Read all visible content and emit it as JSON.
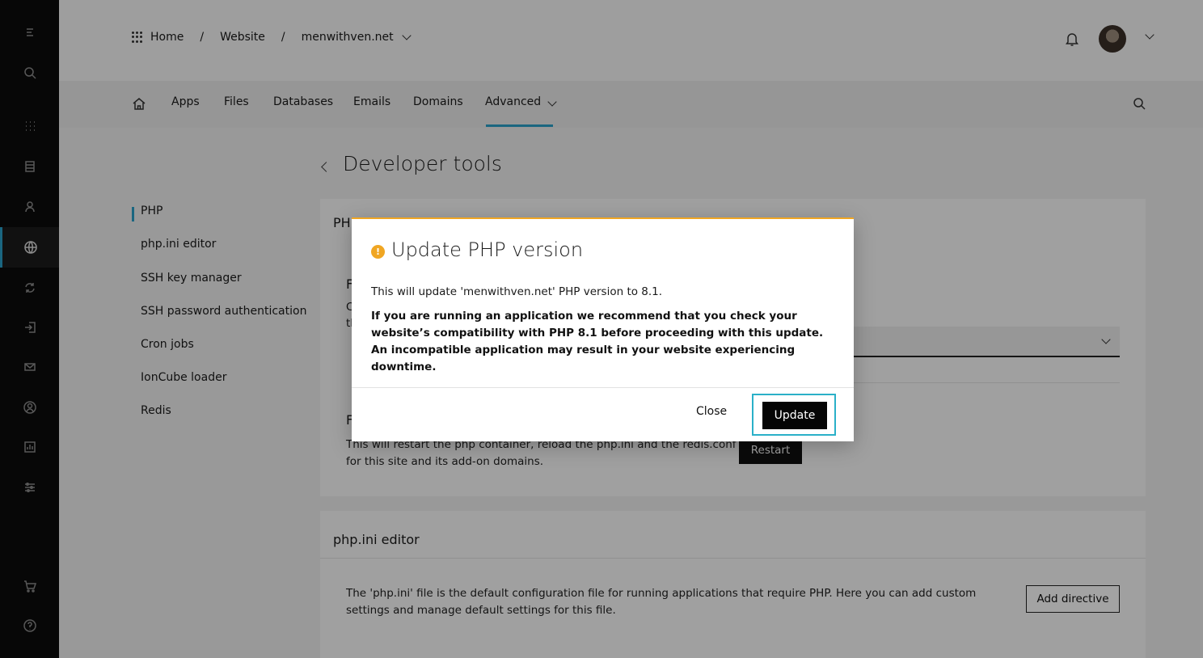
{
  "breadcrumb": {
    "items": [
      "Home",
      "Website",
      "menwithven.net"
    ],
    "separator": "/"
  },
  "nav": {
    "tabs": [
      "Apps",
      "Files",
      "Databases",
      "Emails",
      "Domains",
      "Advanced"
    ],
    "active_tab": "Advanced"
  },
  "page": {
    "title": "Developer tools"
  },
  "subnav": {
    "items": [
      "PHP",
      "php.ini editor",
      "SSH key manager",
      "SSH password authentication",
      "Cron jobs",
      "IonCube loader",
      "Redis"
    ],
    "active": "PHP"
  },
  "php_card": {
    "title_fragment": "PH",
    "section_fragment": "F",
    "text_fragment_1": "C",
    "text_fragment_2": "tl",
    "restart_fragment": "F",
    "restart_text": "This will restart the php container, reload the php.ini and the redis.conf for this site and its add-on domains.",
    "restart_button": "Restart"
  },
  "phpini_card": {
    "title": "php.ini editor",
    "description": "The 'php.ini' file is the default configuration file for running applications that require PHP. Here you can add custom settings and manage default settings for this file.",
    "add_button": "Add directive"
  },
  "modal": {
    "icon": "warning-icon",
    "title": "Update PHP version",
    "message": "This will update 'menwithven.net' PHP version to 8.1.",
    "warning": "If you are running an application we recommend that you check your website’s compatibility with PHP 8.1 before proceeding with this update. An incompatible application may result in your website experiencing downtime.",
    "close_label": "Close",
    "update_label": "Update",
    "accent_color": "#f0a623",
    "focus_color": "#2ab0c8"
  },
  "colors": {
    "rail": "#0b0b0b",
    "accent": "#2aa0c8"
  }
}
